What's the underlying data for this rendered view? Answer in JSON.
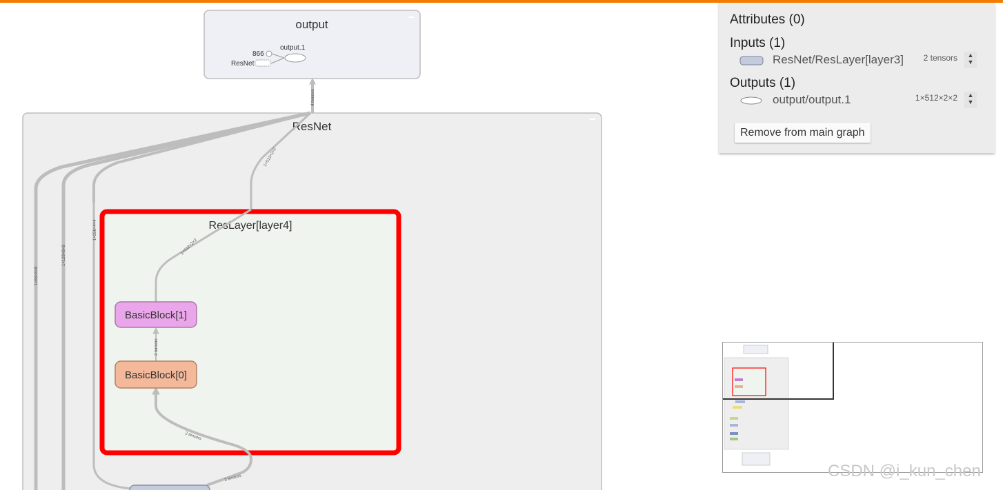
{
  "graph": {
    "output_node": {
      "title": "output",
      "inner_node_label": "output.1",
      "input_count": "866",
      "input_source": "ResNet",
      "edge_label": "4 tensors"
    },
    "resnet_node": {
      "title": "ResNet",
      "edge_labels": [
        "1×512×2×2",
        "1×64×8×8",
        "1×128×8×8",
        "1×256×4×4"
      ]
    },
    "reslayer_node": {
      "title": "ResLayer[layer4]",
      "selected_color": "#ff0000",
      "edge_labels": [
        "1×512×2×2",
        "2 tensors",
        "2 tensors",
        "2 tensors"
      ]
    },
    "blocks": [
      {
        "label": "BasicBlock[1]",
        "color": "#eaa6ea"
      },
      {
        "label": "BasicBlock[0]",
        "color": "#f3b99a"
      }
    ]
  },
  "info_panel": {
    "attributes_heading": "Attributes (0)",
    "inputs_heading": "Inputs (1)",
    "inputs": [
      {
        "name": "ResNet/ResLayer[layer3]",
        "shape": "2 tensors"
      }
    ],
    "outputs_heading": "Outputs (1)",
    "outputs": [
      {
        "name": "output/output.1",
        "shape": "1×512×2×2"
      }
    ],
    "remove_button": "Remove from main graph"
  },
  "watermark": "CSDN @i_kun_chen"
}
